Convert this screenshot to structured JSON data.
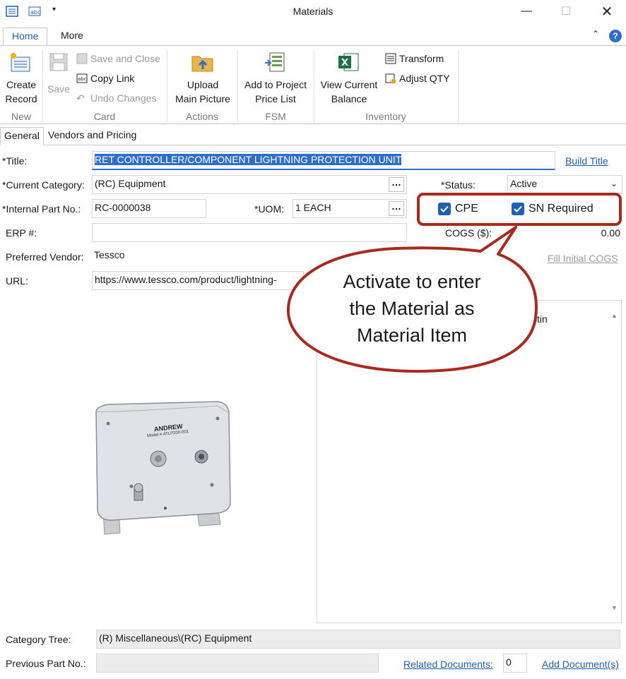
{
  "window": {
    "title": "Materials"
  },
  "ribbon": {
    "tabs": [
      "Home",
      "More"
    ],
    "new": {
      "create_record": "Create\nRecord",
      "label": "New"
    },
    "card": {
      "save": "Save",
      "save_and_close": "Save and Close",
      "copy_link": "Copy Link",
      "undo_changes": "Undo Changes",
      "label": "Card"
    },
    "actions": {
      "upload_main_picture": "Upload\nMain Picture",
      "label": "Actions"
    },
    "fsm": {
      "add_to_price_list": "Add to Project\nPrice List",
      "label": "FSM"
    },
    "inventory": {
      "view_current_balance": "View Current\nBalance",
      "transform": "Transform",
      "adjust_qty": "Adjust QTY",
      "label": "Inventory"
    }
  },
  "form_tabs": [
    "General",
    "Vendors and Pricing"
  ],
  "form": {
    "title_label": "*Title:",
    "title_value": "RET CONTROLLER/COMPONENT LIGHTNING PROTECTION UNIT",
    "build_title": "Build Title",
    "category_label": "*Current Category:",
    "category_value": "(RC) Equipment",
    "status_label": "*Status:",
    "status_value": "Active",
    "part_no_label": "*Internal Part No.:",
    "part_no_value": "RC-0000038",
    "uom_label": "*UOM:",
    "uom_value": "1 EACH",
    "cpe_label": "CPE",
    "sn_required_label": "SN Required",
    "erp_label": "ERP #:",
    "erp_value": "",
    "cogs_label": "COGS ($):",
    "cogs_value": "0.00",
    "preferred_vendor_label": "Preferred Vendor:",
    "preferred_vendor_value": "Tessco",
    "fill_initial_cogs": "Fill Initial COGS",
    "url_label": "URL:",
    "url_value": "https://www.tessco.com/product/lightning-",
    "notes_partial": "stin",
    "product_brand": "ANDREW",
    "product_model": "Model # ATLP200-001",
    "category_tree_label": "Category Tree:",
    "category_tree_value": "(R) Miscellaneous\\(RC) Equipment",
    "previous_part_label": "Previous Part No.:",
    "previous_part_value": "",
    "related_documents": "Related Documents:",
    "related_documents_count": "0",
    "add_documents": "Add Document(s)"
  },
  "callout": {
    "text_line1": "Activate to enter",
    "text_line2": "the Material as",
    "text_line3": "Material Item",
    "color": "#a82a1a"
  }
}
